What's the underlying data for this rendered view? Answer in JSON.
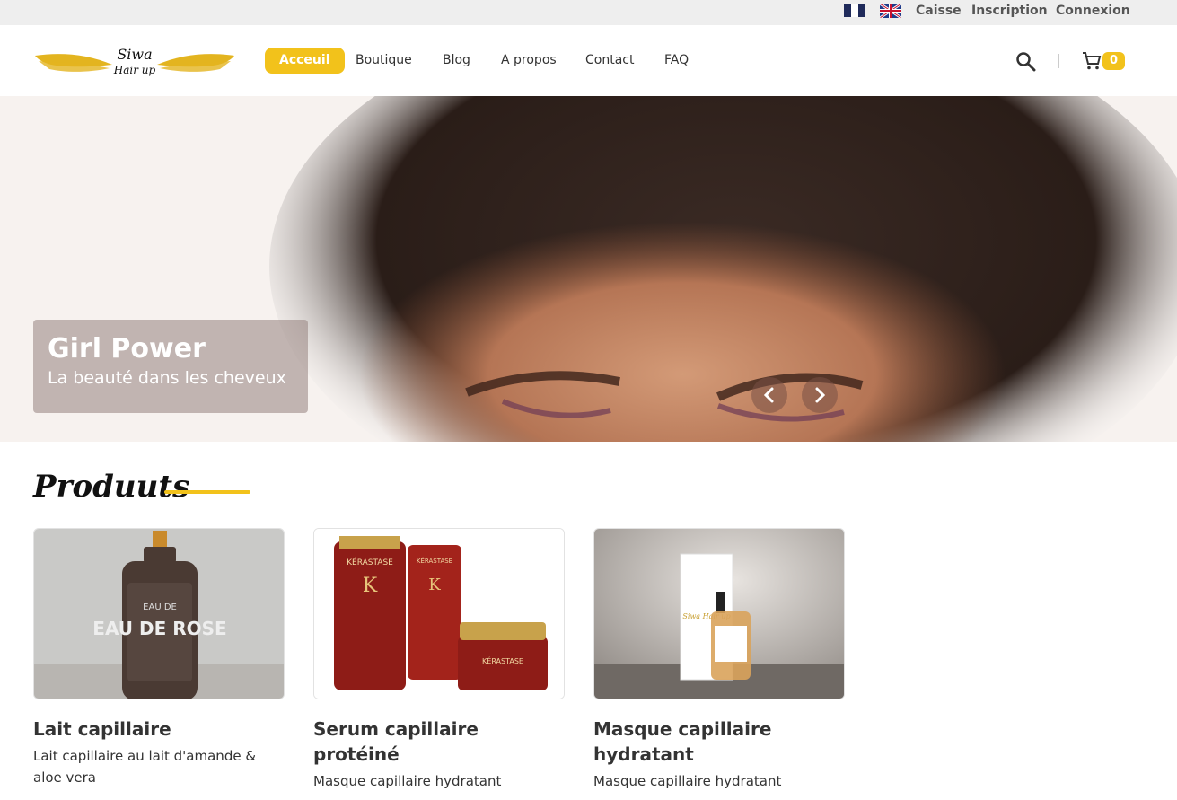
{
  "colors": {
    "accent": "#f2c21b",
    "topbar_bg": "#eeeeee"
  },
  "topbar": {
    "languages": [
      {
        "name": "francais",
        "icon": "flag-fr-icon"
      },
      {
        "name": "english",
        "icon": "flag-uk-icon"
      }
    ],
    "links": [
      "Caisse",
      "Inscription",
      "Connexion"
    ]
  },
  "header": {
    "logo_text": "Siwa Hair up",
    "nav": [
      "Acceuil",
      "Boutique",
      "Blog",
      "A propos",
      "Contact",
      "FAQ"
    ],
    "active_nav": "Acceuil",
    "search_icon": "search-icon",
    "cart_icon": "cart-icon",
    "cart_count": "0"
  },
  "hero": {
    "title": "Girl Power",
    "subtitle": "La beauté dans les cheveux",
    "prev_icon": "chevron-left-icon",
    "next_icon": "chevron-right-icon"
  },
  "products": {
    "section_title": "Produuts",
    "items": [
      {
        "name": "Lait capillaire",
        "description": "Lait capillaire au lait d'amande & aloe vera",
        "image_label": "EAU DE ROSE"
      },
      {
        "name": "Serum capillaire protéiné",
        "description": "Masque capillaire hydratant",
        "image_label": "KÉRASTASE"
      },
      {
        "name": "Masque capillaire hydratant",
        "description": "Masque capillaire hydratant",
        "image_label": "Siwa Hair up"
      }
    ]
  }
}
